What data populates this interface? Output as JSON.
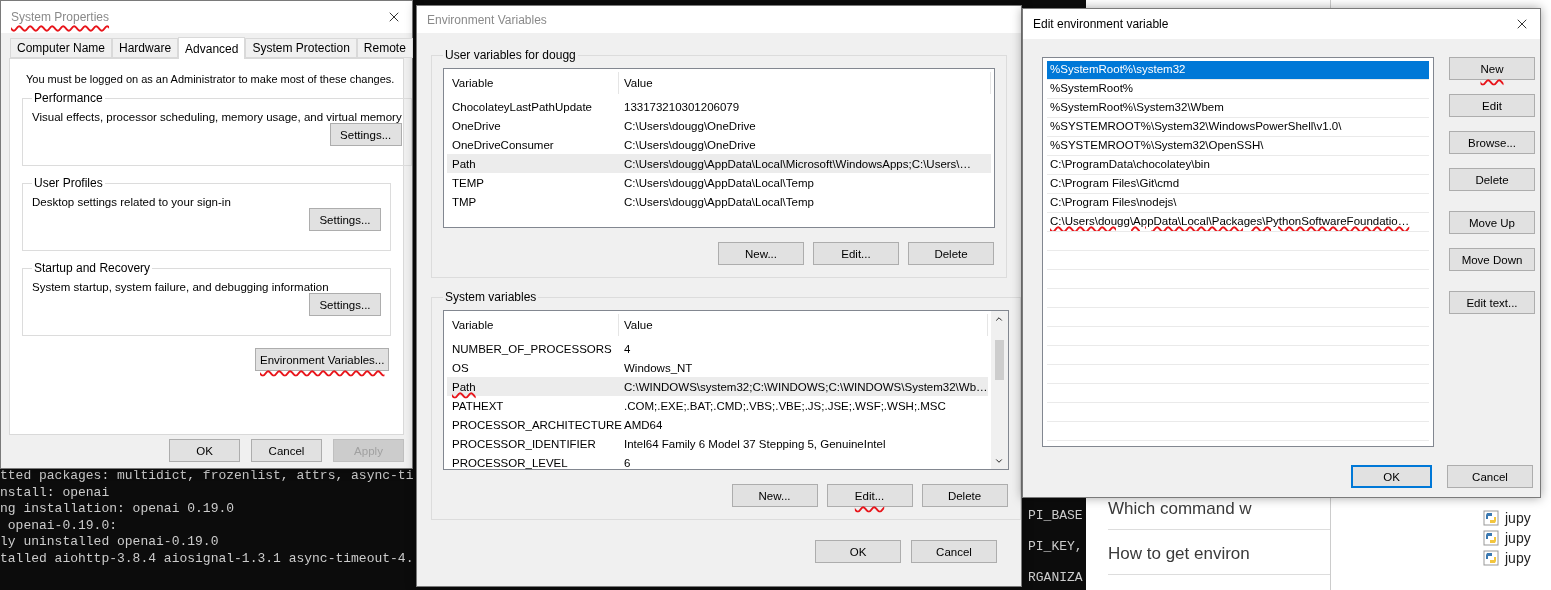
{
  "background": {
    "terminal_lines": [
      "tted packages: multidict, frozenlist, attrs, async-ti",
      "nstall: openai",
      "ng installation: openai 0.19.0",
      " openai-0.19.0:",
      "ly uninstalled openai-0.19.0",
      "talled aiohttp-3.8.4 aiosignal-1.3.1 async-timeout-4."
    ],
    "terminal_right_lines": [
      "PI_BASE",
      "PI_KEY,",
      "RGANIZA"
    ],
    "web_lines": [
      "Which command w",
      "How to get environ"
    ],
    "file_items": [
      "jupy",
      "jupy",
      "jupy"
    ]
  },
  "system_properties": {
    "title": "System Properties",
    "title_underlined": true,
    "tabs": [
      {
        "label": "Computer Name",
        "selected": false
      },
      {
        "label": "Hardware",
        "selected": false
      },
      {
        "label": "Advanced",
        "selected": true
      },
      {
        "label": "System Protection",
        "selected": false
      },
      {
        "label": "Remote",
        "selected": false
      }
    ],
    "notice": "You must be logged on as an Administrator to make most of these changes.",
    "groups": [
      {
        "title": "Performance",
        "description": "Visual effects, processor scheduling, memory usage, and virtual memory",
        "button": "Settings..."
      },
      {
        "title": "User Profiles",
        "description": "Desktop settings related to your sign-in",
        "button": "Settings..."
      },
      {
        "title": "Startup and Recovery",
        "description": "System startup, system failure, and debugging information",
        "button": "Settings..."
      }
    ],
    "env_button": {
      "label": "Environment Variables...",
      "underlined": true
    },
    "buttons": [
      {
        "label": "OK",
        "disabled": false
      },
      {
        "label": "Cancel",
        "disabled": false
      },
      {
        "label": "Apply",
        "disabled": true
      }
    ]
  },
  "environment_variables": {
    "title": "Environment Variables",
    "sections": [
      {
        "title": "User variables for dougg",
        "columns": [
          "Variable",
          "Value"
        ],
        "scrollbar": false,
        "rows": [
          {
            "variable": "ChocolateyLastPathUpdate",
            "value": "133173210301206079",
            "selected": false,
            "underlined": false
          },
          {
            "variable": "OneDrive",
            "value": "C:\\Users\\dougg\\OneDrive",
            "selected": false,
            "underlined": false
          },
          {
            "variable": "OneDriveConsumer",
            "value": "C:\\Users\\dougg\\OneDrive",
            "selected": false,
            "underlined": false
          },
          {
            "variable": "Path",
            "value": "C:\\Users\\dougg\\AppData\\Local\\Microsoft\\WindowsApps;C:\\Users\\…",
            "selected": true,
            "underlined": false
          },
          {
            "variable": "TEMP",
            "value": "C:\\Users\\dougg\\AppData\\Local\\Temp",
            "selected": false,
            "underlined": false
          },
          {
            "variable": "TMP",
            "value": "C:\\Users\\dougg\\AppData\\Local\\Temp",
            "selected": false,
            "underlined": false
          }
        ],
        "buttons": [
          {
            "label": "New...",
            "underlined": false
          },
          {
            "label": "Edit...",
            "underlined": false
          },
          {
            "label": "Delete",
            "underlined": false
          }
        ]
      },
      {
        "title": "System variables",
        "columns": [
          "Variable",
          "Value"
        ],
        "scrollbar": true,
        "rows": [
          {
            "variable": "NUMBER_OF_PROCESSORS",
            "value": "4",
            "selected": false,
            "underlined": false
          },
          {
            "variable": "OS",
            "value": "Windows_NT",
            "selected": false,
            "underlined": false
          },
          {
            "variable": "Path",
            "value": "C:\\WINDOWS\\system32;C:\\WINDOWS;C:\\WINDOWS\\System32\\Wb…",
            "selected": true,
            "underlined": true
          },
          {
            "variable": "PATHEXT",
            "value": ".COM;.EXE;.BAT;.CMD;.VBS;.VBE;.JS;.JSE;.WSF;.WSH;.MSC",
            "selected": false,
            "underlined": false
          },
          {
            "variable": "PROCESSOR_ARCHITECTURE",
            "value": "AMD64",
            "selected": false,
            "underlined": false
          },
          {
            "variable": "PROCESSOR_IDENTIFIER",
            "value": "Intel64 Family 6 Model 37 Stepping 5, GenuineIntel",
            "selected": false,
            "underlined": false
          },
          {
            "variable": "PROCESSOR_LEVEL",
            "value": "6",
            "selected": false,
            "underlined": false
          }
        ],
        "buttons": [
          {
            "label": "New...",
            "underlined": false
          },
          {
            "label": "Edit...",
            "underlined": true
          },
          {
            "label": "Delete",
            "underlined": false
          }
        ]
      }
    ],
    "buttons": [
      "OK",
      "Cancel"
    ]
  },
  "edit_variable": {
    "title": "Edit environment variable",
    "entries": [
      {
        "text": "%SystemRoot%\\system32",
        "selected": true,
        "underlined": false
      },
      {
        "text": "%SystemRoot%",
        "selected": false,
        "underlined": false
      },
      {
        "text": "%SystemRoot%\\System32\\Wbem",
        "selected": false,
        "underlined": false
      },
      {
        "text": "%SYSTEMROOT%\\System32\\WindowsPowerShell\\v1.0\\",
        "selected": false,
        "underlined": false
      },
      {
        "text": "%SYSTEMROOT%\\System32\\OpenSSH\\",
        "selected": false,
        "underlined": false
      },
      {
        "text": "C:\\ProgramData\\chocolatey\\bin",
        "selected": false,
        "underlined": false
      },
      {
        "text": "C:\\Program Files\\Git\\cmd",
        "selected": false,
        "underlined": false
      },
      {
        "text": "C:\\Program Files\\nodejs\\",
        "selected": false,
        "underlined": false
      },
      {
        "text": "C:\\Users\\dougg\\AppData\\Local\\Packages\\PythonSoftwareFoundatio…",
        "selected": false,
        "underlined": true
      }
    ],
    "side_button_groups": [
      [
        {
          "label": "New",
          "underlined": true
        },
        {
          "label": "Edit",
          "underlined": false
        },
        {
          "label": "Browse...",
          "underlined": false
        },
        {
          "label": "Delete",
          "underlined": false
        }
      ],
      [
        {
          "label": "Move Up",
          "underlined": false
        },
        {
          "label": "Move Down",
          "underlined": false
        }
      ],
      [
        {
          "label": "Edit text...",
          "underlined": false
        }
      ]
    ],
    "buttons": [
      {
        "label": "OK",
        "default": true
      },
      {
        "label": "Cancel",
        "default": false
      }
    ]
  }
}
